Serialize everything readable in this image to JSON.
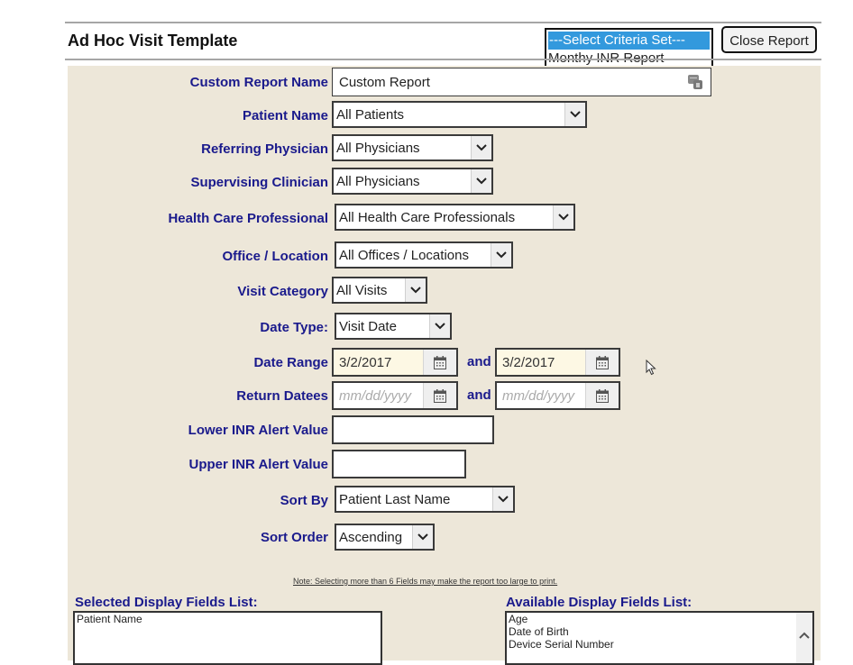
{
  "header": {
    "title": "Ad Hoc Visit Template",
    "criteria_set": {
      "options": [
        "---Select Criteria Set---",
        "Monthy INR Report"
      ],
      "highlighted_index": 0
    },
    "close_button": "Close Report"
  },
  "form": {
    "custom_report_name": {
      "label": "Custom Report Name",
      "value": "Custom Report",
      "icon": "keyboard-icon"
    },
    "patient_name": {
      "label": "Patient Name",
      "value": "All Patients"
    },
    "referring_physician": {
      "label": "Referring Physician",
      "value": "All Physicians"
    },
    "supervising_clinician": {
      "label": "Supervising Clinician",
      "value": "All Physicians"
    },
    "health_care_professional": {
      "label": "Health Care Professional",
      "value": "All Health Care Professionals"
    },
    "office_location": {
      "label": "Office / Location",
      "value": "All Offices / Locations"
    },
    "visit_category": {
      "label": "Visit Category",
      "value": "All Visits"
    },
    "date_type": {
      "label": "Date Type:",
      "value": "Visit Date"
    },
    "date_range": {
      "label": "Date Range",
      "from": "3/2/2017",
      "and_label": "and",
      "to": "3/2/2017"
    },
    "return_dates": {
      "label": "Return Datees",
      "from_placeholder": "mm/dd/yyyy",
      "and_label": "and",
      "to_placeholder": "mm/dd/yyyy"
    },
    "lower_inr": {
      "label": "Lower INR Alert Value",
      "value": ""
    },
    "upper_inr": {
      "label": "Upper INR Alert Value",
      "value": ""
    },
    "sort_by": {
      "label": "Sort By",
      "value": "Patient Last Name"
    },
    "sort_order": {
      "label": "Sort Order",
      "value": "Ascending"
    }
  },
  "note": "Note: Selecting more than 6 Fields may make the report too large to print.",
  "selected_fields": {
    "title": "Selected Display Fields List:",
    "items": [
      "Patient Name"
    ]
  },
  "available_fields": {
    "title": "Available Display Fields List:",
    "items": [
      "Age",
      "Date of Birth",
      "Device Serial Number"
    ]
  },
  "colors": {
    "label_blue": "#1a1a8c",
    "panel_bg": "#ede7d9",
    "date_bg": "#fdf8e4",
    "highlight": "#3399dd"
  }
}
